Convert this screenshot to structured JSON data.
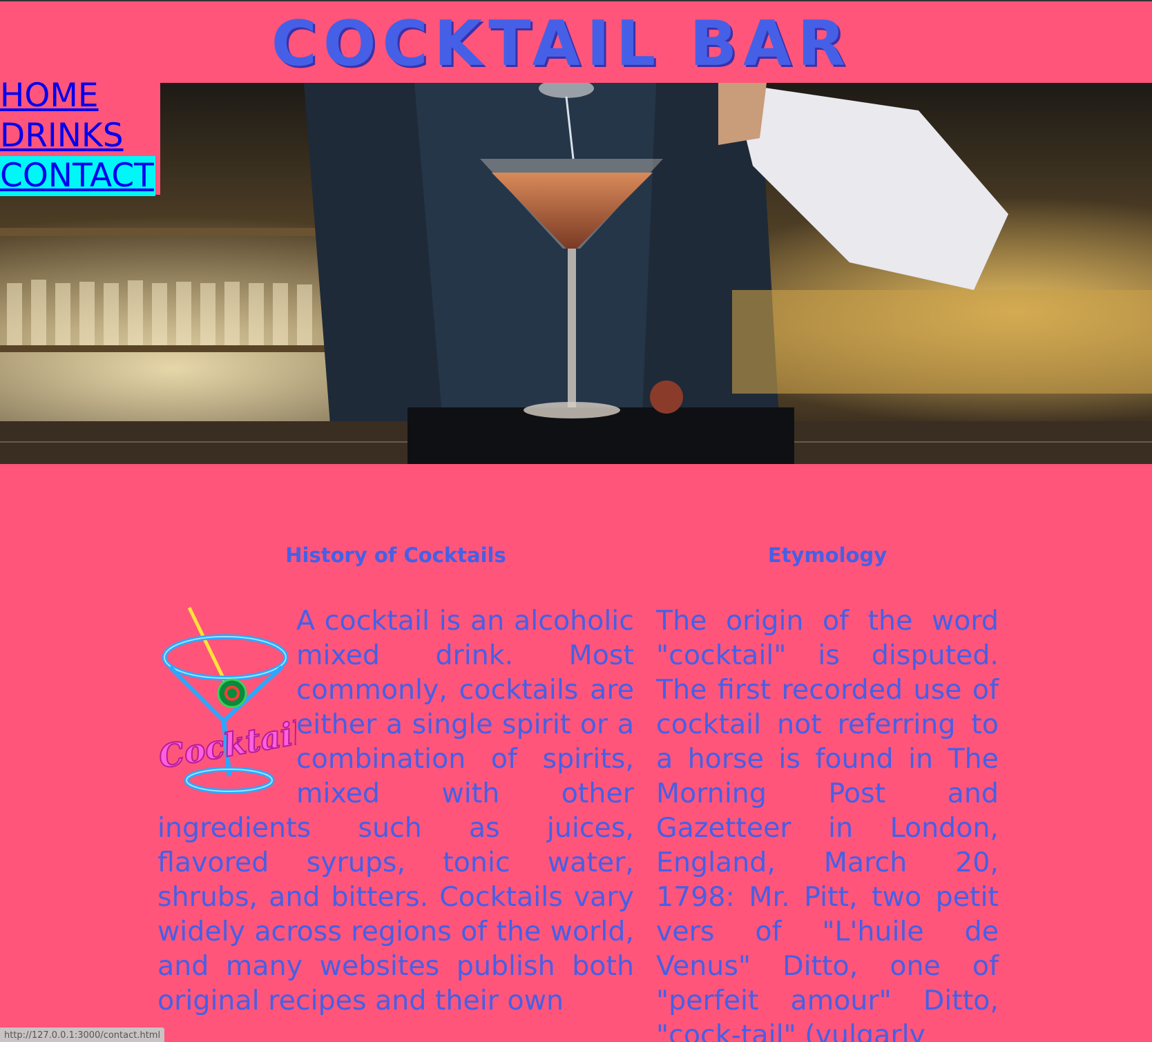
{
  "header": {
    "title": "COCKTAIL BAR"
  },
  "nav": {
    "items": [
      {
        "label": "HOME",
        "active": false
      },
      {
        "label": "DRINKS",
        "active": false
      },
      {
        "label": "CONTACT",
        "active": true
      }
    ]
  },
  "hero": {
    "image": "bartender-pouring-martini-photo"
  },
  "sections": {
    "history": {
      "title": "History of Cocktails",
      "logo_text": "Cocktails",
      "body": "A cocktail is an alcoholic mixed drink. Most commonly, cocktails are either a single spirit or a combination of spirits, mixed with other ingredients such as juices, flavored syrups, tonic water, shrubs, and bitters. Cocktails vary widely across regions of the world, and many websites publish both original recipes and their own"
    },
    "etymology": {
      "title": "Etymology",
      "body": "The origin of the word \"cocktail\" is disputed. The first recorded use of cocktail not referring to a horse is found in The Morning Post and Gazetteer in London, England, March 20, 1798: Mr. Pitt, two petit vers of \"L'huile de Venus\" Ditto, one of \"perfeit amour\" Ditto, \"cock-tail\" (vulgarly"
    }
  },
  "status_bar": {
    "url": "http://127.0.0.1:3000/contact.html"
  },
  "colors": {
    "background": "#ff557a",
    "heading": "#4560e6",
    "link": "#0000ee",
    "active_highlight": "#00f7f7"
  }
}
